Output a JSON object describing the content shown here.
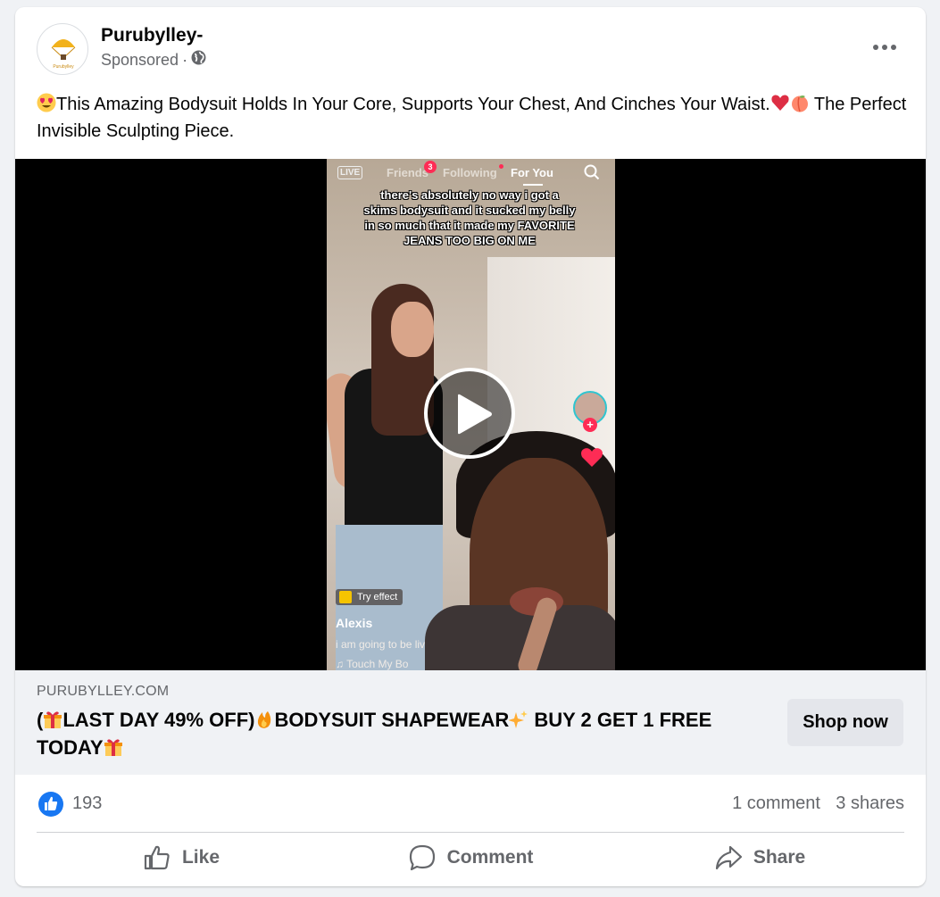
{
  "post": {
    "page_name": "Purubylley-",
    "sponsored_label": "Sponsored",
    "sponsored_separator": "·",
    "text_part1": "This Amazing Bodysuit Holds In Your Core, Supports Your Chest, And Cinches Your Waist.",
    "text_part2": " The Perfect Invisible Sculpting Piece.",
    "avatar_logo_text": "Purubylley"
  },
  "video": {
    "tiktok_tabs": {
      "live": "LIVE",
      "friends": "Friends",
      "friends_badge": "3",
      "following": "Following",
      "for_you": "For You"
    },
    "caption": "there's absolutely no way i got a skims bodysuit and it sucked my belly in so much that it made my FAVORITE JEANS TOO BIG ON ME",
    "try_effect": "Try effect",
    "username": "Alexis",
    "description": "i am going to be liv",
    "music": "♫ Touch My Bo"
  },
  "link": {
    "domain": "PURUBYLLEY.COM",
    "headline_a": "(",
    "headline_b": "LAST DAY 49% OFF)",
    "headline_c": "BODYSUIT SHAPEWEAR",
    "headline_d": " BUY 2 GET 1 FREE TODAY",
    "cta": "Shop now"
  },
  "stats": {
    "likes": "193",
    "comments": "1 comment",
    "shares": "3 shares"
  },
  "actions": {
    "like": "Like",
    "comment": "Comment",
    "share": "Share"
  },
  "colors": {
    "facebook_blue": "#1877f2",
    "tiktok_red": "#fe2c55",
    "secondary_text": "#65676b"
  }
}
